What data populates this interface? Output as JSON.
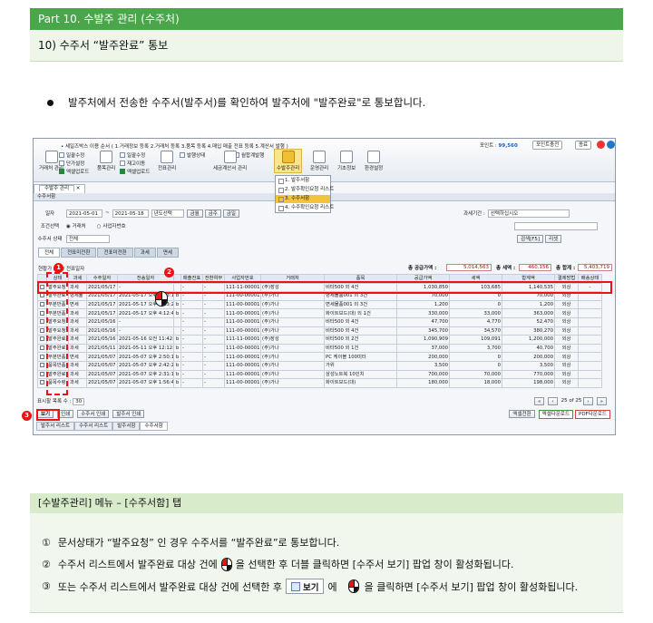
{
  "header": {
    "part": "Part 10. 수발주 관리 (수주처)",
    "section": "10) 수주서 “발주완료” 통보"
  },
  "intro": "발주처에서 전송한 수주서(발주서)를 확인하여 발주처에 \"발주완료\"로 통보합니다.",
  "app": {
    "notice": "• 세일즈박스 이용 순서 ( 1.거래정보 등록  2.거래처 등록  3.품목 등록  4.매입 매출 전표 등록  5.계산서 발행 )",
    "point_label": "포인트 :",
    "point_value": "99,560",
    "point_btn": "포인트충전",
    "settings_btn": "종료",
    "toolbar": [
      {
        "label": "거래처\n관리",
        "icon": "people-icon"
      },
      {
        "label": "",
        "icon": ""
      },
      {
        "label": "품목관리",
        "icon": "box-icon"
      },
      {
        "label": "",
        "icon": ""
      },
      {
        "label": "전표관리",
        "icon": "document-icon"
      },
      {
        "label": "",
        "icon": ""
      },
      {
        "label": "세금계산서\n관리",
        "icon": "invoice-icon"
      },
      {
        "label": "",
        "icon": ""
      },
      {
        "label": "수발주관리",
        "icon": "order-icon"
      },
      {
        "label": "운영관리",
        "icon": "monitor-icon"
      },
      {
        "label": "기초정보",
        "icon": "database-icon"
      },
      {
        "label": "환경설정",
        "icon": "settings-icon"
      }
    ],
    "sub_left": [
      "일괄수정",
      "단가설정",
      "엑셀업로드"
    ],
    "sub_mid": [
      "일괄수정",
      "재고이동",
      "엑셀업로드"
    ],
    "sub_right": [
      "발행상태",
      "월합계발행"
    ],
    "dropdown": [
      "1. 발주서함",
      "2. 발주확인요청 리스트",
      "3. 수주서함",
      "4. 수주확인요청 리스트"
    ],
    "tab_main": "수발주 관리",
    "panel_title": "수주서함",
    "form": {
      "date_label": "일자",
      "date_from": "2021-05-01",
      "date_to": "2021-05-18",
      "year_select": "년도선택",
      "q_buttons": [
        "금월",
        "금주",
        "금일"
      ],
      "cond_label": "조건선택",
      "radio1": "거래처",
      "radio2": "사업자번호",
      "status_label": "수주서 상태",
      "status_value": "전체",
      "period_label": "과세기간 :",
      "period_value": "선택하십시오",
      "search_btn": "검색[F5]",
      "reset_btn": "리셋"
    },
    "status_tabs": [
      "전체",
      "전표미전환",
      "전표미전환",
      "과세",
      "면세"
    ],
    "sums": {
      "supply_label": "총 공급가액 :",
      "supply_value": "5,014,563",
      "tax_label": "총 세액 :",
      "tax_value": "460,156",
      "total_label": "총 합계 :",
      "total_value": "5,403,719"
    },
    "grid_caption": "현황가 / 번 / 전표일자",
    "columns": [
      "",
      "상태",
      "과세",
      "수주일자",
      "전송일자",
      "",
      "매출전표",
      "전환여부",
      "사업자번호",
      "거래처",
      "품목",
      "공급가액",
      "세액",
      "합계액",
      "결제방법",
      "배송상태"
    ],
    "rows": [
      [
        "",
        "발주요청",
        "과세",
        "2021/05/17",
        "-",
        "",
        "-",
        "-",
        "111-11-00001",
        "(주)장성",
        "비타500 외 4건",
        "1,030,850",
        "103,685",
        "1,140,535",
        "외상",
        "-"
      ],
      [
        "",
        "발주완료",
        "영세율",
        "2021/05/17",
        "2021-05-17 오후 4:13:18",
        "b",
        "-",
        "-",
        "111-00-00001",
        "(주)가나",
        "영세물품001 외 3건",
        "70,000",
        "0",
        "70,000",
        "외상",
        ""
      ],
      [
        "",
        "부분반품",
        "면세",
        "2021/05/17",
        "2021-05-17 오후 4:13:29",
        "b",
        "-",
        "-",
        "111-00-00001",
        "(주)가나",
        "면세물품001 외 3건",
        "1,200",
        "0",
        "1,200",
        "외상",
        ""
      ],
      [
        "",
        "부분반품",
        "과세",
        "2021/05/17",
        "2021-05-17 오후 4:12:43",
        "b",
        "-",
        "-",
        "111-00-00001",
        "(주)가나",
        "화이트보드(대) 외 1건",
        "330,000",
        "33,000",
        "363,000",
        "외상",
        ""
      ],
      [
        "",
        "발주요청",
        "과세",
        "2021/05/16",
        "-",
        "",
        "-",
        "-",
        "111-00-00001",
        "(주)가나",
        "비타500 외 4건",
        "47,700",
        "4,770",
        "52,470",
        "외상",
        ""
      ],
      [
        "",
        "발주요청",
        "과세",
        "2021/05/16",
        "-",
        "",
        "-",
        "-",
        "111-00-00001",
        "(주)가나",
        "비타500 외 4건",
        "345,700",
        "34,570",
        "380,270",
        "외상",
        ""
      ],
      [
        "",
        "발주완료",
        "과세",
        "2021/05/16",
        "2021-05-16 오전 11:42:00",
        "b",
        "-",
        "-",
        "111-11-00001",
        "(주)장성",
        "비타500 외 2건",
        "1,090,909",
        "109,091",
        "1,200,000",
        "외상",
        ""
      ],
      [
        "",
        "발주완료",
        "과세",
        "2021/05/11",
        "2021-05-11 오후 12:12:31",
        "b",
        "-",
        "-",
        "111-00-00001",
        "(주)가나",
        "비타500 외 1건",
        "37,000",
        "3,700",
        "40,700",
        "외상",
        ""
      ],
      [
        "",
        "부분반품",
        "면세",
        "2021/05/07",
        "2021-05-07 오후 2:50:18",
        "b",
        "-",
        "-",
        "111-00-00001",
        "(주)가나",
        "PC 케이블 100미터",
        "200,000",
        "0",
        "200,000",
        "외상",
        ""
      ],
      [
        "",
        "품목반품",
        "과세",
        "2021/05/07",
        "2021-05-07 오후 2:42:28",
        "b",
        "-",
        "-",
        "111-00-00001",
        "(주)가나",
        "가위",
        "3,500",
        "0",
        "3,500",
        "외상",
        ""
      ],
      [
        "",
        "발주완료",
        "과세",
        "2021/05/07",
        "2021-05-07 오후 2:31:13",
        "b",
        "-",
        "-",
        "111-00-00001",
        "(주)가나",
        "삼성노트북 10인치",
        "700,000",
        "70,000",
        "770,000",
        "외상",
        ""
      ],
      [
        "",
        "품목수령",
        "과세",
        "2021/05/07",
        "2021-05-07 오후 1:56:45",
        "b",
        "-",
        "-",
        "111-00-00001",
        "(주)가나",
        "화이트보드(대)",
        "180,000",
        "18,000",
        "198,000",
        "외상",
        ""
      ]
    ],
    "page_size_label": "표시할 목록 수 :",
    "page_size": "30",
    "page_info": "25 of 25",
    "bottom_left": [
      "보기",
      "인쇄",
      "수주서 인쇄",
      "발주서 인쇄"
    ],
    "bottom_right": [
      "엑셀전환",
      "엑셀다운로드",
      "PDF다운로드"
    ],
    "bottom_tabs": [
      "발주서 리스트",
      "수주서 리스트",
      "발주서함",
      "수주서함"
    ],
    "markers": [
      "1",
      "2",
      "3"
    ]
  },
  "notes": {
    "head": "[수발주관리] 메뉴 – [수주서함] 탭",
    "n1": "①",
    "line1": "문서상태가 “발주요청” 인 경우 수주서를 “발주완료”로 통보합니다.",
    "n2": "②",
    "line2a": "수주서 리스트에서 발주완료 대상 건에",
    "line2b": "을 선택한 후 더블 클릭하면 [수주서 보기] 팝업 창이 활성화됩니다.",
    "n3": "③",
    "line3a": "또는 수주서 리스트에서 발주완료 대상 건에  선택한 후",
    "line3_btn": "보기",
    "line3b": "에",
    "line3c": "을 클릭하면 [수주서 보기] 팝업 창이 활성화됩니다."
  },
  "colors": {
    "header_green": "#49a64a",
    "section_bg": "#eef6e9",
    "highlight_red": "#e11111"
  }
}
